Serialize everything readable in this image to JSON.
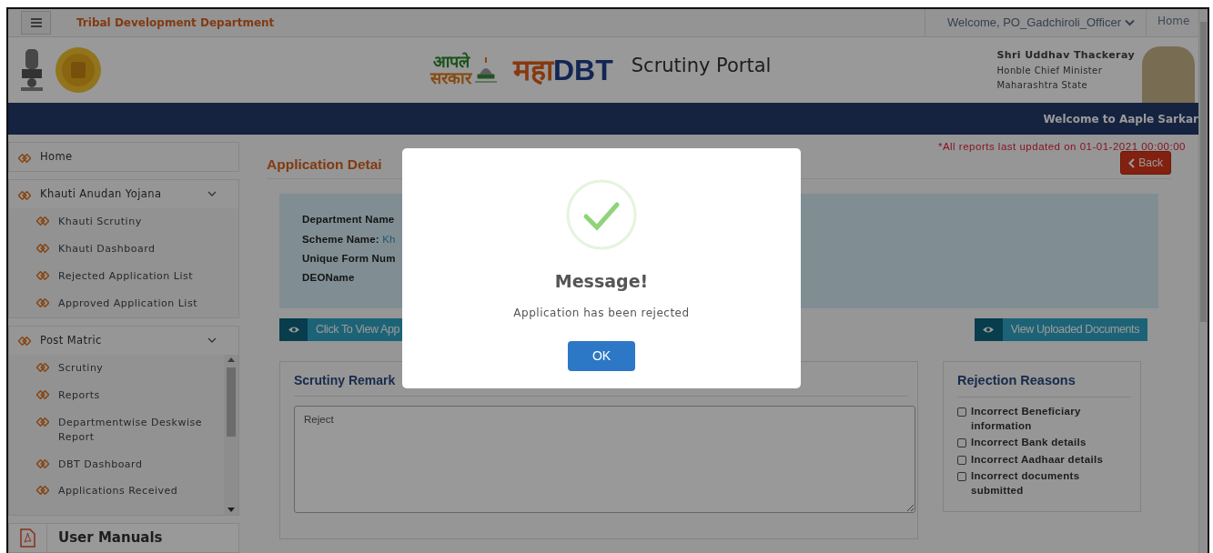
{
  "topbar": {
    "department": "Tribal Development Department",
    "user_menu": "Welcome, PO_Gadchiroli_Officer",
    "home_link": "Home"
  },
  "header": {
    "logo_lines": [
      "आपले",
      "सरकार"
    ],
    "brand": {
      "prefix": "महा",
      "suffix": "DBT"
    },
    "portal_title": "Scrutiny Portal",
    "dignitary": {
      "name": "Shri Uddhav Thackeray",
      "role": "Honble Chief Minister",
      "state": "Maharashtra State"
    }
  },
  "ticker": "Welcome to Aaple Sarkar",
  "sidebar": {
    "items": [
      {
        "label": "Home"
      },
      {
        "label": "Khauti Anudan Yojana",
        "expanded": true,
        "children": [
          {
            "label": "Khauti Scrutiny"
          },
          {
            "label": "Khauti Dashboard"
          },
          {
            "label": "Rejected Application List"
          },
          {
            "label": "Approved Application List"
          }
        ]
      },
      {
        "label": "Post Matric",
        "expanded": true,
        "children": [
          {
            "label": "Scrutiny"
          },
          {
            "label": "Reports"
          },
          {
            "label": "Departmentwise Deskwise Report"
          },
          {
            "label": "DBT Dashboard"
          },
          {
            "label": "Applications Received"
          }
        ]
      }
    ],
    "manuals": "User Manuals"
  },
  "content": {
    "notice": "*All reports last updated on 01-01-2021 00:00:00",
    "back_button": "Back",
    "heading": "Application Detai",
    "details": [
      {
        "label": "Department Name"
      },
      {
        "label": "Scheme Name:",
        "value": "Kh"
      },
      {
        "label": "Unique Form Num"
      },
      {
        "label": "DEOName"
      }
    ],
    "view_application_button": "Click To View App",
    "view_documents_button": "View Uploaded Documents",
    "remarks": {
      "title": "Scrutiny Remark",
      "value": "Reject"
    },
    "rejection_reasons": {
      "title": "Rejection Reasons",
      "options": [
        {
          "label": "Incorrect Beneficiary information",
          "checked": false
        },
        {
          "label": "Incorrect Bank details",
          "checked": false
        },
        {
          "label": "Incorrect Aadhaar details",
          "checked": false
        },
        {
          "label": "Incorrect documents submitted",
          "checked": false
        }
      ]
    }
  },
  "dialog": {
    "title": "Message!",
    "message": "Application has been rejected",
    "ok_button": "OK"
  }
}
